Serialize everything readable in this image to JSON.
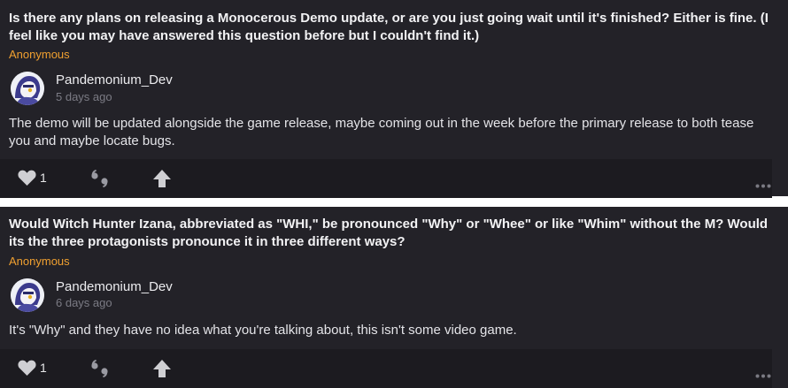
{
  "posts": [
    {
      "question": "Is there any plans on releasing a Monocerous Demo update, or are you just going wait until it's finished? Either is fine. (I feel like you may have answered this question before but I couldn't find it.)",
      "asker": "Anonymous",
      "author": "Pandemonium_Dev",
      "time": "5 days ago",
      "answer": "The demo will be updated alongside the game release, maybe coming out in the week before the primary release to both tease you and maybe locate bugs.",
      "likes": "1"
    },
    {
      "question": "Would Witch Hunter Izana, abbreviated as \"WHI,\" be pronounced \"Why\" or \"Whee\" or like \"Whim\" without the M? Would its the three protagonists pronounce it in three different ways?",
      "asker": "Anonymous",
      "author": "Pandemonium_Dev",
      "time": "6 days ago",
      "answer": "It's \"Why\" and they have no idea what you're talking about, this isn't some video game.",
      "likes": "1"
    }
  ],
  "icons": {
    "like": "heart-icon",
    "quote": "quote-icon",
    "upvote": "upvote-arrow-icon",
    "more": "more-options-icon",
    "avatar": "avatar"
  },
  "colors": {
    "card_bg": "#232228",
    "action_bar_bg": "#1c1b20",
    "asker": "#f0a030",
    "timestamp": "#7b7b84",
    "icon": "#cfcfd3"
  }
}
